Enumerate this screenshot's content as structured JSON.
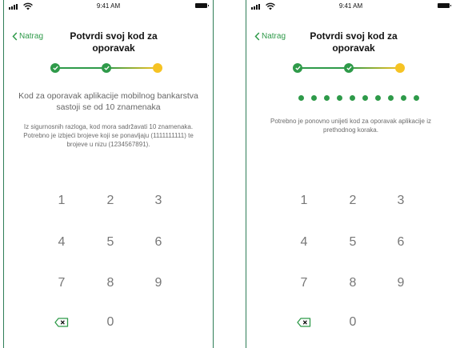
{
  "status_bar": {
    "time": "9:41 AM"
  },
  "screens": [
    {
      "back_label": "Natrag",
      "title": "Potvrdi svoj kod za oporavak",
      "main_text": "Kod za oporavak aplikacije mobilnog bankarstva sastoji se od 10 znamenaka",
      "sub_text": "Iz sigurnosnih razloga, kod mora sadržavati 10 znamenaka. Potrebno je izbjeći brojeve koji se ponavljaju (1111111111) te brojeve u nizu (1234567891).",
      "steps": [
        "done",
        "done",
        "active"
      ],
      "keys": [
        "1",
        "2",
        "3",
        "4",
        "5",
        "6",
        "7",
        "8",
        "9",
        "",
        "0"
      ],
      "backspace_icon": "backspace-icon"
    },
    {
      "back_label": "Natrag",
      "title": "Potvrdi svoj kod za oporavak",
      "entered_digits": 10,
      "sub_text": "Potrebno je ponovno unijeti kod za oporavak aplikacije iz prethodnog koraka.",
      "steps": [
        "done",
        "done",
        "active"
      ],
      "keys": [
        "1",
        "2",
        "3",
        "4",
        "5",
        "6",
        "7",
        "8",
        "9",
        "",
        "0"
      ],
      "backspace_icon": "backspace-icon"
    }
  ],
  "colors": {
    "accent_green": "#2e9a49",
    "active_yellow": "#f6c323",
    "border": "#2f7d57"
  }
}
